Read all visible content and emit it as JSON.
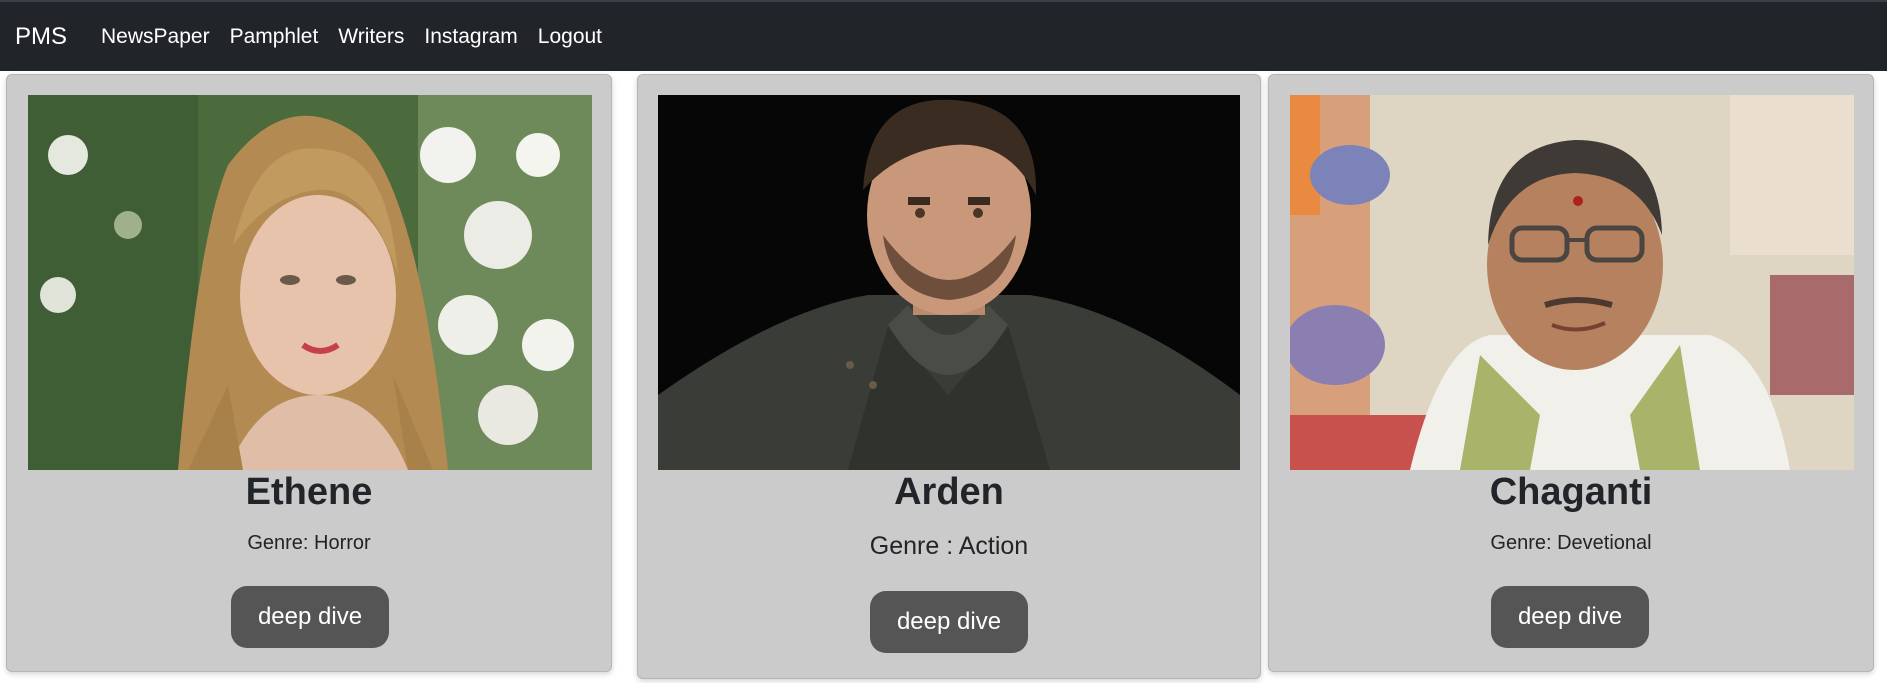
{
  "navbar": {
    "brand": "PMS",
    "links": [
      "NewsPaper",
      "Pamphlet",
      "Writers",
      "Instagram",
      "Logout"
    ]
  },
  "writers": [
    {
      "name": "Ethene",
      "genre": "Genre: Horror",
      "button": "deep dive"
    },
    {
      "name": "Arden",
      "genre": "Genre : Action",
      "button": "deep dive"
    },
    {
      "name": "Chaganti",
      "genre": "Genre: Devetional",
      "button": "deep dive"
    }
  ],
  "colors": {
    "navbar_bg": "#212529",
    "card_bg": "#cbcbcb",
    "button_bg": "#555555"
  }
}
